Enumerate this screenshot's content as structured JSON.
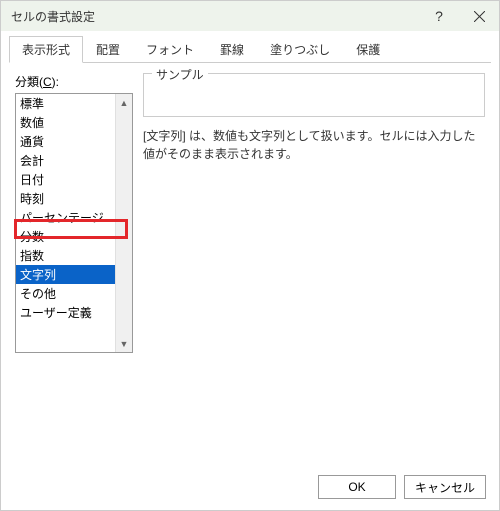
{
  "window": {
    "title": "セルの書式設定",
    "help": "?",
    "close": "×"
  },
  "tabs": {
    "items": [
      {
        "label": "表示形式"
      },
      {
        "label": "配置"
      },
      {
        "label": "フォント"
      },
      {
        "label": "罫線"
      },
      {
        "label": "塗りつぶし"
      },
      {
        "label": "保護"
      }
    ]
  },
  "category": {
    "label_pre": "分類(",
    "label_u": "C",
    "label_post": "):",
    "items": [
      "標準",
      "数値",
      "通貨",
      "会計",
      "日付",
      "時刻",
      "パーセンテージ",
      "分数",
      "指数",
      "文字列",
      "その他",
      "ユーザー定義"
    ],
    "selected_index": 9
  },
  "sample": {
    "label": "サンプル"
  },
  "description": "[文字列] は、数値も文字列として扱います。セルには入力した値がそのまま表示されます。",
  "buttons": {
    "ok": "OK",
    "cancel": "キャンセル"
  }
}
